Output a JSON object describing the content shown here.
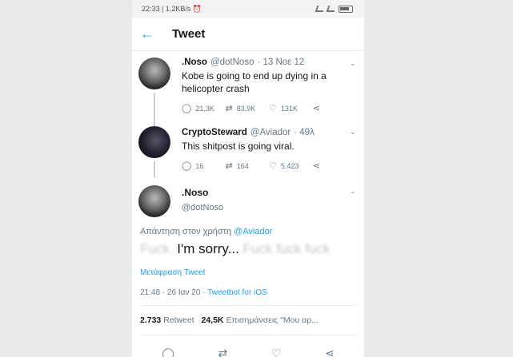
{
  "statusbar": {
    "left": "22:33 | 1,2KB/s ⏰",
    "right": ""
  },
  "header": {
    "back_icon": "arrow-left-icon",
    "title": "Tweet"
  },
  "thread": [
    {
      "name": ".Noso",
      "handle": "@dotNoso",
      "time": "· 13 Νοε 12",
      "text": "Kobe is going to end up dying in a helicopter crash",
      "replies": "21,3K",
      "retweets": "83,9K",
      "likes": "131K"
    },
    {
      "name": "CryptoSteward",
      "handle": "@Aviador",
      "time": "· 49λ",
      "text": "This shitpost is going viral.",
      "replies": "16",
      "retweets": "164",
      "likes": "5.423"
    }
  ],
  "main": {
    "name": ".Noso",
    "handle": "@dotNoso",
    "replying_prefix": "Απάντηση στον χρήστη",
    "replying_mention": "@Aviador",
    "text_blur_1": "Fuck.",
    "text_main": " I'm sorry...",
    "text_blur_2": " Fuck fuck fuck",
    "translate": "Μετάφραση Tweet",
    "timestamp": "21:48 · 26 Ιαν 20 · ",
    "app": "Tweetbot for iOS",
    "retweets_count": "2.733",
    "retweets_label": "Retweet",
    "likes_count": "24,5K",
    "likes_label": "Επισημάνσεις \"Μου αρ..."
  }
}
